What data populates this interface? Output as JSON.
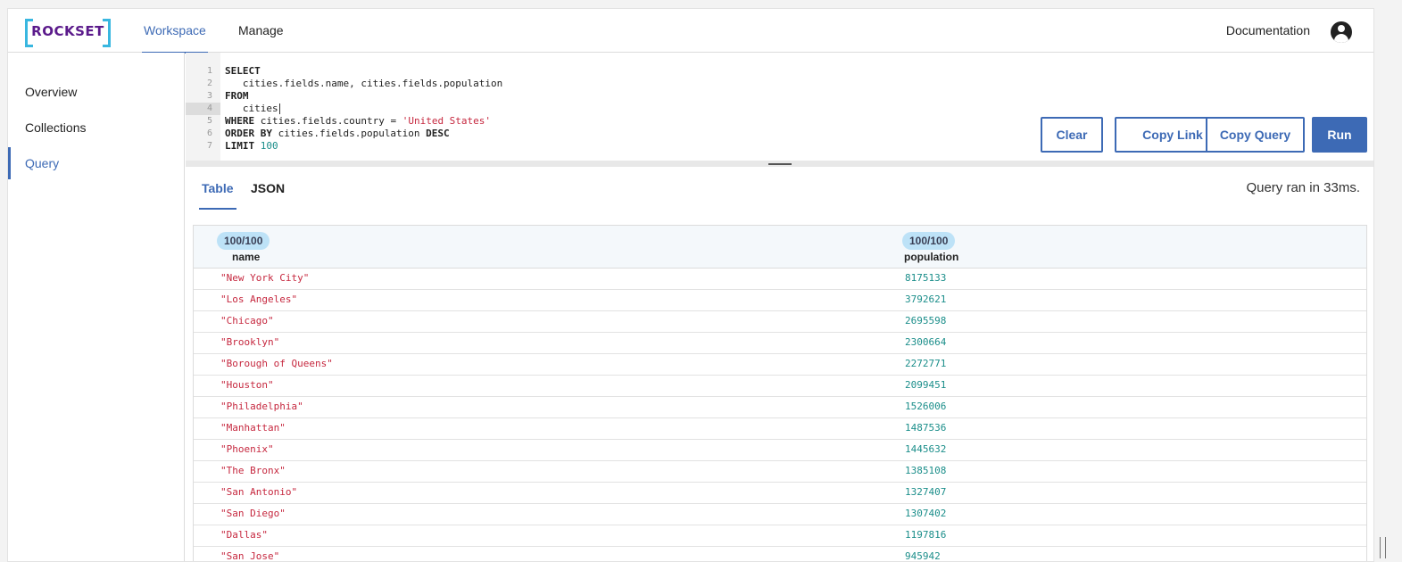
{
  "header": {
    "logo_text": "ROCKSET",
    "tabs": [
      {
        "label": "Workspace",
        "active": true
      },
      {
        "label": "Manage",
        "active": false
      }
    ],
    "documentation_label": "Documentation",
    "avatar_icon": "user-circle-icon"
  },
  "sidebar": {
    "items": [
      {
        "label": "Overview",
        "active": false
      },
      {
        "label": "Collections",
        "active": false
      },
      {
        "label": "Query",
        "active": true
      }
    ]
  },
  "editor": {
    "line_numbers": [
      "1",
      "2",
      "3",
      "4",
      "5",
      "6",
      "7"
    ],
    "active_line": 4,
    "code": [
      [
        {
          "t": "SELECT",
          "k": "kw"
        }
      ],
      [
        {
          "t": "   cities.fields.name, cities.fields.population",
          "k": ""
        }
      ],
      [
        {
          "t": "FROM",
          "k": "kw"
        }
      ],
      [
        {
          "t": "   cities",
          "k": ""
        }
      ],
      [
        {
          "t": "WHERE",
          "k": "kw"
        },
        {
          "t": " cities.fields.country = ",
          "k": ""
        },
        {
          "t": "'United States'",
          "k": "str"
        }
      ],
      [
        {
          "t": "ORDER BY",
          "k": "kw"
        },
        {
          "t": " cities.fields.population ",
          "k": ""
        },
        {
          "t": "DESC",
          "k": "kw"
        }
      ],
      [
        {
          "t": "LIMIT",
          "k": "kw"
        },
        {
          "t": " ",
          "k": ""
        },
        {
          "t": "100",
          "k": "num"
        }
      ]
    ]
  },
  "buttons": {
    "clear": "Clear",
    "copy_link": "Copy Link",
    "copy_query": "Copy Query",
    "run": "Run"
  },
  "results": {
    "tabs": [
      {
        "label": "Table",
        "active": true
      },
      {
        "label": "JSON",
        "active": false
      }
    ],
    "runtime_text": "Query ran in 33ms.",
    "columns": [
      {
        "name": "name",
        "badge": "100/100"
      },
      {
        "name": "population",
        "badge": "100/100"
      }
    ],
    "rows": [
      [
        "\"New York City\"",
        "8175133"
      ],
      [
        "\"Los Angeles\"",
        "3792621"
      ],
      [
        "\"Chicago\"",
        "2695598"
      ],
      [
        "\"Brooklyn\"",
        "2300664"
      ],
      [
        "\"Borough of Queens\"",
        "2272771"
      ],
      [
        "\"Houston\"",
        "2099451"
      ],
      [
        "\"Philadelphia\"",
        "1526006"
      ],
      [
        "\"Manhattan\"",
        "1487536"
      ],
      [
        "\"Phoenix\"",
        "1445632"
      ],
      [
        "\"The Bronx\"",
        "1385108"
      ],
      [
        "\"San Antonio\"",
        "1327407"
      ],
      [
        "\"San Diego\"",
        "1307402"
      ],
      [
        "\"Dallas\"",
        "1197816"
      ],
      [
        "\"San Jose\"",
        "945942"
      ]
    ]
  }
}
